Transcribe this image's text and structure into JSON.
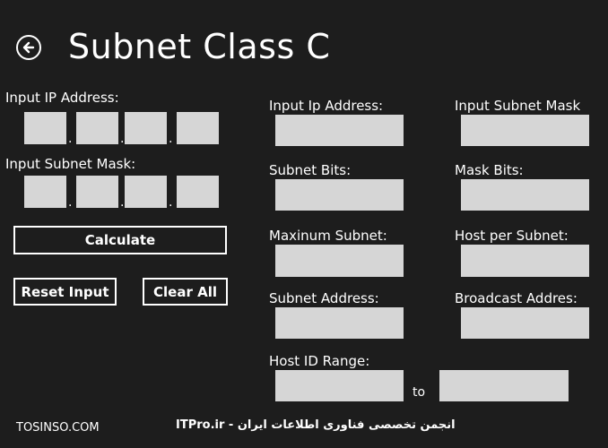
{
  "header": {
    "title": "Subnet Class C",
    "back_icon": "back-arrow-icon"
  },
  "left_panel": {
    "ip_label": "Input IP Address:",
    "ip_octets": [
      "",
      "",
      "",
      ""
    ],
    "mask_label": "Input Subnet Mask:",
    "mask_octets": [
      "",
      "",
      "",
      ""
    ],
    "separator": ".",
    "calculate_label": "Calculate",
    "reset_label": "Reset Input",
    "clear_label": "Clear All"
  },
  "results": {
    "input_ip_label": "Input Ip Address:",
    "input_ip_value": "",
    "input_mask_label": "Input Subnet Mask",
    "input_mask_value": "",
    "subnet_bits_label": "Subnet Bits:",
    "subnet_bits_value": "",
    "mask_bits_label": "Mask Bits:",
    "mask_bits_value": "",
    "max_subnet_label": "Maxinum Subnet:",
    "max_subnet_value": "",
    "host_per_subnet_label": "Host per Subnet:",
    "host_per_subnet_value": "",
    "subnet_address_label": "Subnet Address:",
    "subnet_address_value": "",
    "broadcast_label": "Broadcast Addres:",
    "broadcast_value": "",
    "host_range_label": "Host ID Range:",
    "host_range_start": "",
    "host_range_to": "to",
    "host_range_end": ""
  },
  "footer": {
    "watermark_left": "TOSINSO.COM",
    "watermark_center": "ITPro.ir - انجمن تخصصی فناوری اطلاعات ایران"
  },
  "colors": {
    "background": "#1d1d1d",
    "field": "#d6d6d6",
    "text": "#ffffff"
  }
}
